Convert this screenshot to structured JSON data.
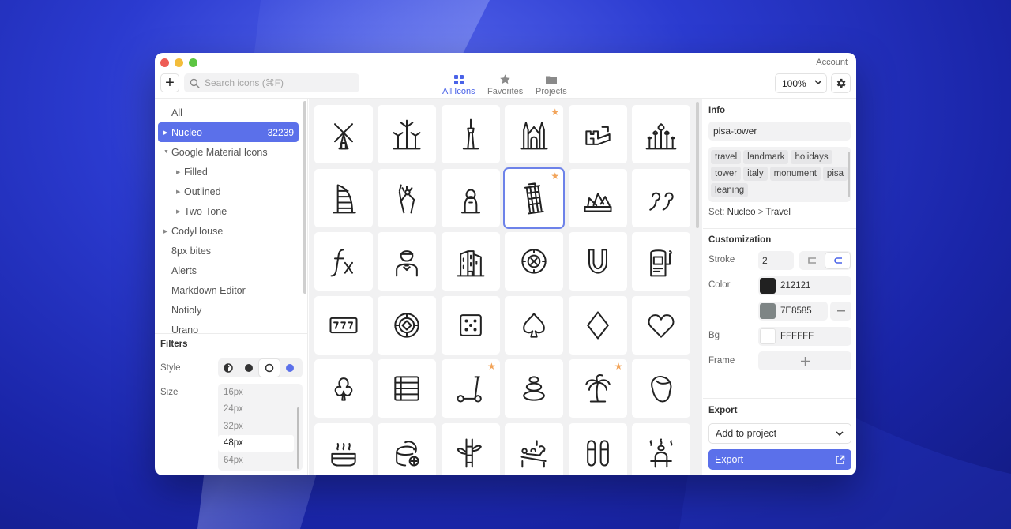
{
  "window": {
    "account_label": "Account"
  },
  "toolbar": {
    "add_label": "+",
    "search_placeholder": "Search icons (⌘F)",
    "tabs": [
      {
        "label": "All Icons",
        "icon": "grid-icon",
        "active": true
      },
      {
        "label": "Favorites",
        "icon": "star-icon",
        "active": false
      },
      {
        "label": "Projects",
        "icon": "folder-icon",
        "active": false
      }
    ],
    "zoom_value": "100%",
    "accent_color": "#4a63e8"
  },
  "sidebar": {
    "items": [
      {
        "label": "All",
        "count": "",
        "arrow": "",
        "indent": 0
      },
      {
        "label": "Nucleo",
        "count": "32239",
        "arrow": "▶",
        "indent": 0,
        "active": true
      },
      {
        "label": "Google Material Icons",
        "count": "",
        "arrow": "▼",
        "indent": 0
      },
      {
        "label": "Filled",
        "count": "",
        "arrow": "▶",
        "indent": 1
      },
      {
        "label": "Outlined",
        "count": "",
        "arrow": "▶",
        "indent": 1
      },
      {
        "label": "Two-Tone",
        "count": "",
        "arrow": "▶",
        "indent": 1
      },
      {
        "label": "CodyHouse",
        "count": "",
        "arrow": "▶",
        "indent": 0
      },
      {
        "label": "8px bites",
        "count": "",
        "arrow": "",
        "indent": 0
      },
      {
        "label": "Alerts",
        "count": "",
        "arrow": "",
        "indent": 0
      },
      {
        "label": "Markdown Editor",
        "count": "",
        "arrow": "",
        "indent": 0
      },
      {
        "label": "Notioly",
        "count": "",
        "arrow": "",
        "indent": 0
      },
      {
        "label": "Urano",
        "count": "",
        "arrow": "",
        "indent": 0
      }
    ]
  },
  "filters": {
    "title": "Filters",
    "style_label": "Style",
    "size_label": "Size",
    "sizes": [
      "16px",
      "24px",
      "32px",
      "48px",
      "64px"
    ],
    "selected_size": "48px"
  },
  "grid": {
    "icons": [
      {
        "name": "windmill-icon",
        "fav": false
      },
      {
        "name": "wind-turbines-icon",
        "fav": false
      },
      {
        "name": "cn-tower-icon",
        "fav": false
      },
      {
        "name": "sagrada-familia-icon",
        "fav": true
      },
      {
        "name": "great-wall-icon",
        "fav": false
      },
      {
        "name": "st-basil-cathedral-icon",
        "fav": false
      },
      {
        "name": "burj-al-arab-icon",
        "fav": false
      },
      {
        "name": "statue-of-liberty-icon",
        "fav": false
      },
      {
        "name": "sphinx-icon",
        "fav": false
      },
      {
        "name": "pisa-tower-icon",
        "fav": true,
        "selected": true
      },
      {
        "name": "sydney-opera-house-icon",
        "fav": false
      },
      {
        "name": "quote-icon",
        "fav": false
      },
      {
        "name": "function-icon",
        "fav": false
      },
      {
        "name": "waiter-icon",
        "fav": false
      },
      {
        "name": "hotel-building-icon",
        "fav": false
      },
      {
        "name": "roulette-icon",
        "fav": false
      },
      {
        "name": "horseshoe-icon",
        "fav": false
      },
      {
        "name": "slot-machine-icon",
        "fav": false
      },
      {
        "name": "jackpot-777-icon",
        "fav": false
      },
      {
        "name": "casino-chip-icon",
        "fav": false
      },
      {
        "name": "dice-icon",
        "fav": false
      },
      {
        "name": "spade-icon",
        "fav": false
      },
      {
        "name": "diamond-icon",
        "fav": false
      },
      {
        "name": "heart-icon",
        "fav": false
      },
      {
        "name": "club-icon",
        "fav": false
      },
      {
        "name": "table-icon",
        "fav": false
      },
      {
        "name": "scooter-icon",
        "fav": true
      },
      {
        "name": "zen-stones-icon",
        "fav": false
      },
      {
        "name": "palm-tree-icon",
        "fav": true
      },
      {
        "name": "towel-head-icon",
        "fav": false
      },
      {
        "name": "hot-tub-icon",
        "fav": false
      },
      {
        "name": "cream-jar-icon",
        "fav": false
      },
      {
        "name": "bamboo-icon",
        "fav": false
      },
      {
        "name": "massage-icon",
        "fav": false
      },
      {
        "name": "slippers-icon",
        "fav": false
      },
      {
        "name": "sauna-icon",
        "fav": false
      }
    ],
    "star_color": "#f2a45a"
  },
  "info": {
    "title": "Info",
    "name": "pisa-tower",
    "tags": [
      "travel",
      "landmark",
      "holidays",
      "tower",
      "italy",
      "monument",
      "pisa",
      "leaning"
    ],
    "set_prefix": "Set:",
    "set_name": "Nucleo",
    "set_separator": ">",
    "set_category": "Travel"
  },
  "customization": {
    "title": "Customization",
    "stroke_label": "Stroke",
    "stroke_value": "2",
    "color_label": "Color",
    "color_primary": "212121",
    "color_secondary": "7E8585",
    "bg_label": "Bg",
    "bg_value": "FFFFFF",
    "frame_label": "Frame",
    "primary_hex": "#212121",
    "secondary_hex": "#7e8585",
    "bg_hex": "#ffffff"
  },
  "export": {
    "title": "Export",
    "add_to_project": "Add to project",
    "export_label": "Export",
    "button_color": "#5b70ea"
  }
}
